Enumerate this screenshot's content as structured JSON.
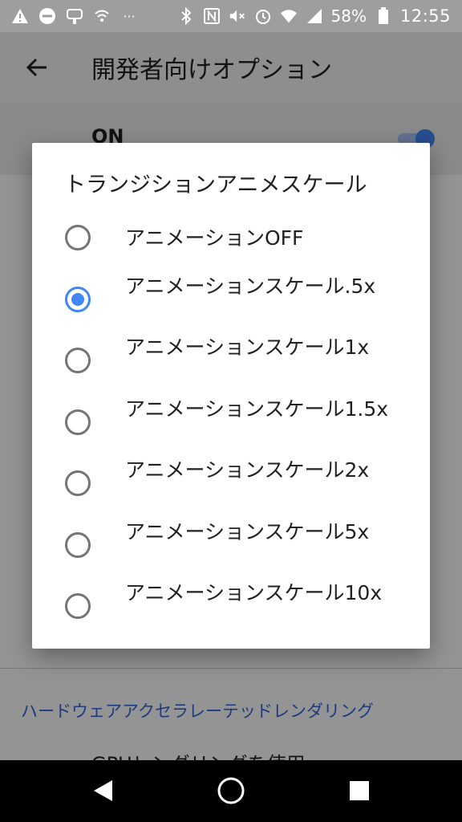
{
  "status_bar": {
    "icons": [
      "warning-icon",
      "do-not-disturb-icon",
      "voicemail-icon",
      "wifi-calling-icon",
      "more-notifications-icon",
      "bluetooth-icon",
      "nfc-icon",
      "mute-icon",
      "alarm-icon",
      "wifi-icon",
      "signal-icon",
      "battery-icon"
    ],
    "more_dots": "···",
    "battery_percent": "58%",
    "time": "12:55"
  },
  "app_bar": {
    "title": "開発者向けオプション"
  },
  "master_switch": {
    "label": "ON",
    "state": "on"
  },
  "dialog": {
    "title": "トランジションアニメスケール",
    "selected_index": 1,
    "options": [
      {
        "label": "アニメーションOFF"
      },
      {
        "label": "アニメーションスケール.5x"
      },
      {
        "label": "アニメーションスケール1x"
      },
      {
        "label": "アニメーションスケール1.5x"
      },
      {
        "label": "アニメーションスケール2x"
      },
      {
        "label": "アニメーションスケール5x"
      },
      {
        "label": "アニメーションスケール10x"
      }
    ]
  },
  "background": {
    "section_header": "ハードウェアアクセラレーテッドレンダリング",
    "partial_item": "GPUレンダリングを使用"
  },
  "nav_bar": {
    "buttons": [
      "back-icon",
      "home-icon",
      "recents-icon"
    ]
  },
  "colors": {
    "accent": "#4285f4",
    "section_header": "#3367d6",
    "scrim": "rgba(0,0,0,0.42)"
  }
}
